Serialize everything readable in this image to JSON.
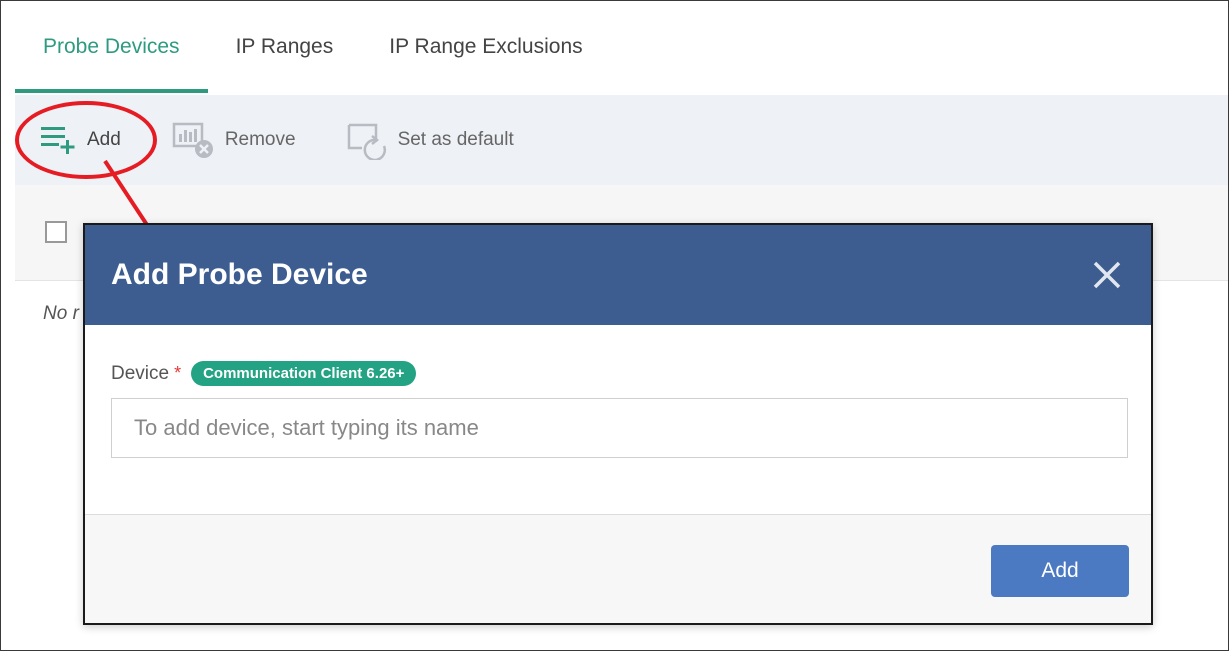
{
  "tabs": [
    {
      "label": "Probe Devices",
      "active": true
    },
    {
      "label": "IP Ranges",
      "active": false
    },
    {
      "label": "IP Range Exclusions",
      "active": false
    }
  ],
  "toolbar": {
    "add_label": "Add",
    "remove_label": "Remove",
    "set_default_label": "Set as default"
  },
  "table": {
    "empty_text": "No r"
  },
  "modal": {
    "title": "Add Probe Device",
    "device_label": "Device",
    "required_mark": "*",
    "badge": "Communication Client 6.26+",
    "device_placeholder": "To add device, start typing its name",
    "device_value": "",
    "submit_label": "Add"
  },
  "colors": {
    "accent_green": "#2e9b80",
    "modal_header": "#3d5d91",
    "primary_button": "#4c7ac2",
    "annotation_red": "#e51c23",
    "badge_green": "#23a383"
  },
  "icons": {
    "add": "list-add-icon",
    "remove": "remove-device-icon",
    "set_default": "set-default-icon",
    "close": "close-icon"
  }
}
